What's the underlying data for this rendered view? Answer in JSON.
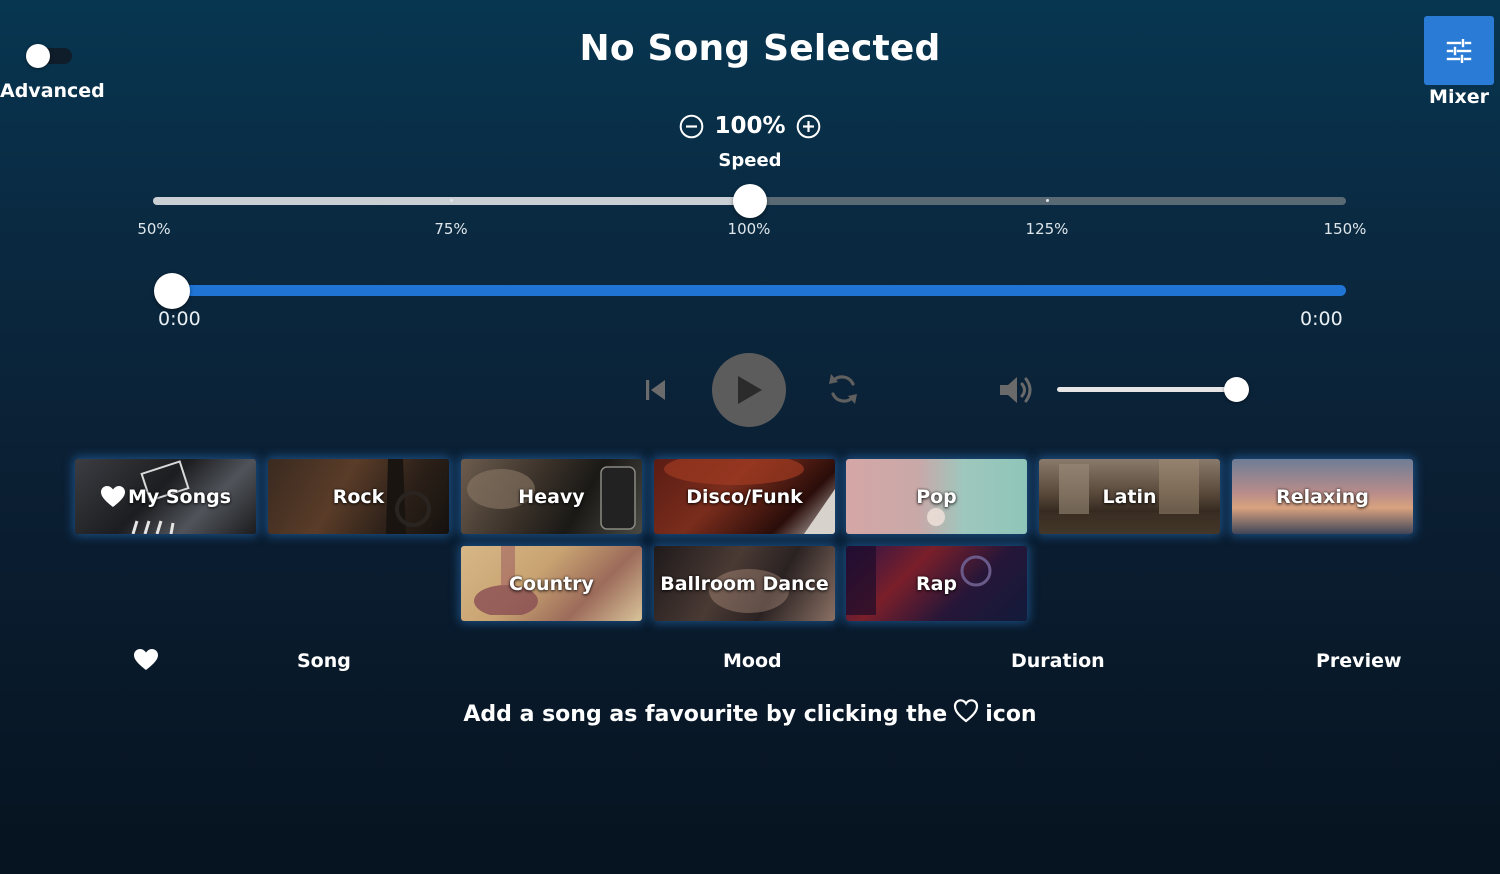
{
  "header": {
    "title": "No Song Selected",
    "advanced_label": "Advanced",
    "advanced_enabled": false,
    "mixer_label": "Mixer"
  },
  "speed": {
    "value": "100%",
    "label": "Speed",
    "current_percent": 100,
    "min_percent": 50,
    "max_percent": 150,
    "ticks": [
      "50%",
      "75%",
      "100%",
      "125%",
      "150%"
    ]
  },
  "progress": {
    "current_time": "0:00",
    "total_time": "0:00",
    "fraction": 0
  },
  "volume": {
    "fraction": 1
  },
  "genres": [
    {
      "label": "My Songs",
      "icon": "heart-icon"
    },
    {
      "label": "Rock"
    },
    {
      "label": "Heavy"
    },
    {
      "label": "Disco/Funk"
    },
    {
      "label": "Pop"
    },
    {
      "label": "Latin"
    },
    {
      "label": "Relaxing"
    },
    {
      "label": "Country"
    },
    {
      "label": "Ballroom Dance"
    },
    {
      "label": "Rap"
    }
  ],
  "table": {
    "columns": [
      "Song",
      "Mood",
      "Duration",
      "Preview"
    ],
    "favourite_icon": "heart-icon"
  },
  "empty_hint": {
    "before": "Add a song as favourite by clicking the",
    "after": "icon"
  },
  "colors": {
    "accent": "#2a7bd6",
    "progress": "#1f74d4",
    "play_button": "#5c5c5c"
  }
}
